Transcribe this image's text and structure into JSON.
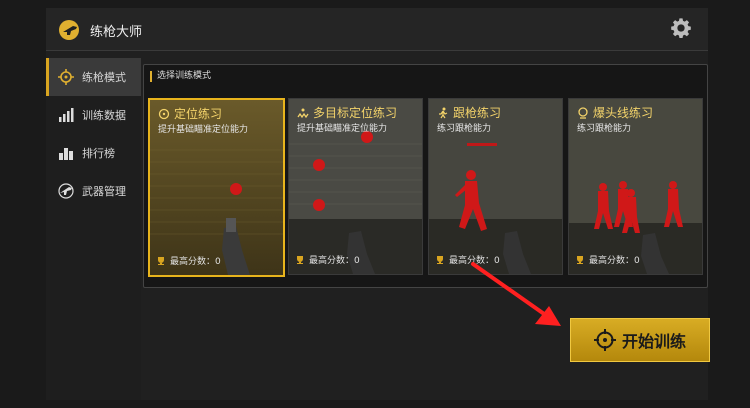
{
  "app": {
    "title": "练枪大师"
  },
  "sidebar": {
    "items": [
      {
        "label": "练枪模式",
        "icon": "crosshair-icon",
        "active": true
      },
      {
        "label": "训练数据",
        "icon": "bar-chart-icon",
        "active": false
      },
      {
        "label": "排行榜",
        "icon": "leaderboard-icon",
        "active": false
      },
      {
        "label": "武器管理",
        "icon": "gun-icon",
        "active": false
      }
    ]
  },
  "panel": {
    "title": "选择训练模式"
  },
  "modes": [
    {
      "title": "定位练习",
      "subtitle": "提升基础瞄准定位能力",
      "score_label": "最高分数：0",
      "icon": "crosshair-icon",
      "selected": true
    },
    {
      "title": "多目标定位练习",
      "subtitle": "提升基础瞄准定位能力",
      "score_label": "最高分数：0",
      "icon": "multi-target-icon",
      "selected": false
    },
    {
      "title": "跟枪练习",
      "subtitle": "练习跟枪能力",
      "score_label": "最高分数：0",
      "icon": "running-icon",
      "selected": false
    },
    {
      "title": "爆头线练习",
      "subtitle": "练习跟枪能力",
      "score_label": "最高分数：0",
      "icon": "head-icon",
      "selected": false
    }
  ],
  "start_button": {
    "label": "开始训练",
    "icon": "crosshair-icon"
  },
  "colors": {
    "accent": "#d9a520",
    "target": "#d01818",
    "background": "#1a1a1a"
  }
}
